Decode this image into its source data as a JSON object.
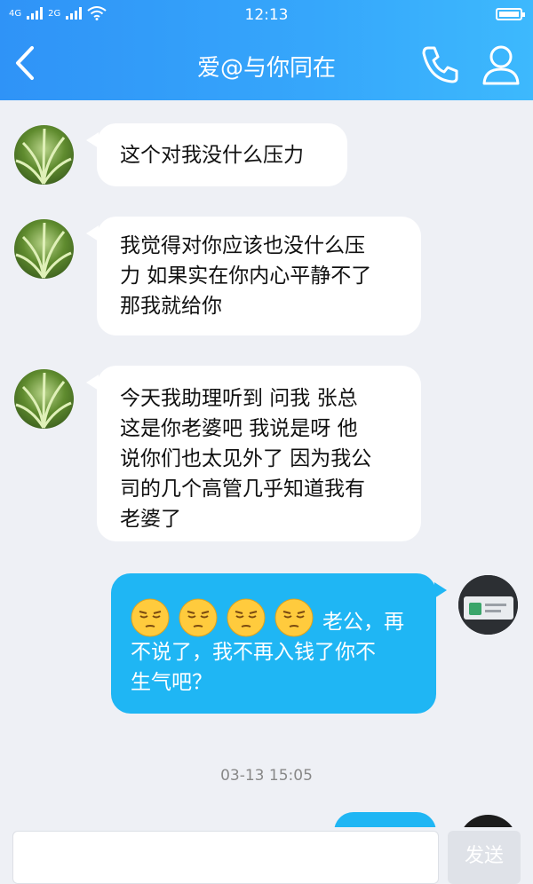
{
  "status_bar": {
    "time": "12:13",
    "net1": "4G",
    "net2": "2G"
  },
  "header": {
    "title": "爱@与你同在"
  },
  "messages": [
    {
      "lines": [
        "这个对我没什么压力"
      ]
    },
    {
      "lines": [
        "我觉得对你应该也没什么压",
        "力 如果实在你内心平静不了",
        "那我就给你"
      ]
    },
    {
      "lines": [
        "今天我助理听到 问我 张总",
        "这是你老婆吧 我说是呀 他",
        "说你们也太见外了 因为我公",
        "司的几个高管几乎知道我有",
        "老婆了"
      ]
    },
    {
      "lines_after_emoji": "老公，再",
      "lines": [
        "不说了，我不再入钱了你不",
        "生气吧？"
      ],
      "emoji_count": 4
    }
  ],
  "timestamp": "03-13 15:05",
  "input": {
    "placeholder": "",
    "send_label": "发送"
  },
  "colors": {
    "header_accent": "#2f93f7",
    "outgoing_bubble": "#1fb6f4"
  }
}
